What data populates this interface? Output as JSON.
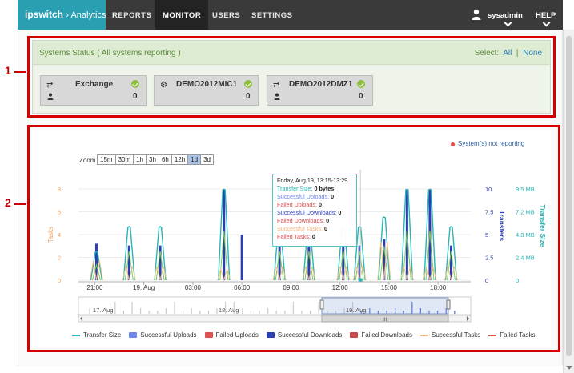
{
  "nav": {
    "brand": "ipswitch",
    "brand_suffix": "› Analytics",
    "items": [
      {
        "label": "REPORTS"
      },
      {
        "label": "MONITOR"
      },
      {
        "label": "USERS"
      },
      {
        "label": "SETTINGS"
      }
    ],
    "user": "sysadmin",
    "help": "HELP"
  },
  "annotations": {
    "marker1": "1",
    "marker2": "2"
  },
  "systems_status": {
    "title": "Systems Status ( All systems reporting )",
    "select_label": "Select:",
    "select_all": "All",
    "select_sep": "|",
    "select_none": "None",
    "systems": [
      {
        "name": "Exchange",
        "count": "0",
        "icon": "transfer-icon"
      },
      {
        "name": "DEMO2012MIC1",
        "count": "0",
        "icon": "gears-icon"
      },
      {
        "name": "DEMO2012DMZ1",
        "count": "0",
        "icon": "transfer-icon"
      }
    ]
  },
  "chart_panel": {
    "not_reporting": "System(s) not reporting",
    "zoom_label": "Zoom",
    "zoom_options": [
      "15m",
      "30m",
      "1h",
      "3h",
      "6h",
      "12h",
      "1d",
      "3d"
    ],
    "zoom_selected": "1d",
    "tooltip": {
      "time": "Friday, Aug 19, 13:15-13:29",
      "rows": [
        {
          "label": "Transfer Size:",
          "value": "0 bytes",
          "color": "#29b5b5"
        },
        {
          "label": "Successful Uploads:",
          "value": "0",
          "color": "#6e86e6"
        },
        {
          "label": "Failed Uploads:",
          "value": "0",
          "color": "#d9534f"
        },
        {
          "label": "Successful Downloads:",
          "value": "0",
          "color": "#2a3fb4"
        },
        {
          "label": "Failed Downloads:",
          "value": "0",
          "color": "#c94a4a"
        },
        {
          "label": "Successful Tasks:",
          "value": "0",
          "color": "#f2b37a"
        },
        {
          "label": "Failed Tasks:",
          "value": "0",
          "color": "#e04b4b"
        }
      ]
    },
    "navigator": {
      "labels": [
        "17. Aug",
        "18. Aug",
        "19. Aug"
      ],
      "handle": "III"
    },
    "legend": [
      {
        "name": "Transfer Size",
        "color": "#29b5b5",
        "kind": "line"
      },
      {
        "name": "Successful Uploads",
        "color": "#6e86e6",
        "kind": "box"
      },
      {
        "name": "Failed Uploads",
        "color": "#d9534f",
        "kind": "box"
      },
      {
        "name": "Successful Downloads",
        "color": "#2a3fb4",
        "kind": "box"
      },
      {
        "name": "Failed Downloads",
        "color": "#c94a4a",
        "kind": "box"
      },
      {
        "name": "Successful Tasks",
        "color": "#f2b37a",
        "kind": "line"
      },
      {
        "name": "Failed Tasks",
        "color": "#e04b4b",
        "kind": "line"
      }
    ]
  },
  "chart_data": {
    "type": "line",
    "x_ticks": [
      "21:00",
      "19. Aug",
      "03:00",
      "06:00",
      "09:00",
      "12:00",
      "15:00",
      "18:00"
    ],
    "y_left": {
      "label": "Tasks",
      "ticks": [
        "0",
        "2",
        "4",
        "6",
        "8"
      ],
      "range": [
        0,
        8
      ]
    },
    "y_right1": {
      "label": "Transfers",
      "ticks": [
        "0",
        "2.5",
        "5",
        "7.5",
        "10"
      ],
      "range": [
        0,
        10
      ]
    },
    "y_right2": {
      "label": "Transfer Size",
      "ticks": [
        "0",
        "2.4 MB",
        "4.8 MB",
        "7.2 MB",
        "9.5 MB"
      ]
    },
    "spike_hours": [
      0.1,
      2.1,
      4.0,
      7.9,
      9.0,
      11.3,
      13.1,
      15.2,
      16.2,
      17.7,
      19.1,
      20.5,
      21.8
    ],
    "transfers_peak": [
      4.0,
      3.8,
      3.8,
      10.0,
      5.0,
      3.8,
      3.8,
      3.8,
      3.8,
      4.5,
      10.0,
      10.0,
      3.8
    ],
    "transfer_size_peak_mb": [
      2.9,
      5.5,
      5.5,
      9.4,
      0.0,
      5.5,
      5.5,
      5.5,
      5.5,
      6.5,
      9.4,
      9.4,
      5.5
    ],
    "tasks_peak": [
      1.7,
      1.2,
      1.2,
      1.0,
      0.0,
      1.2,
      1.2,
      1.2,
      1.2,
      3.4,
      1.2,
      1.2,
      1.2
    ],
    "x_range_hours": [
      -1.0,
      23.0
    ],
    "tooltip_hour": 16.25
  }
}
